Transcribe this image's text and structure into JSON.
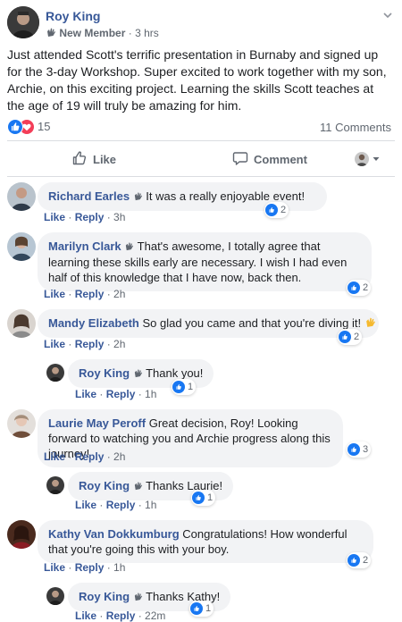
{
  "post": {
    "author": "Roy King",
    "badge": "New Member",
    "time": "3 hrs",
    "text": "Just attended Scott's terrific presentation in Burnaby and signed up for the 3-day Workshop. Super excited to work together with my son, Archie, on this exciting project. Learning the skills Scott teaches at the age of 19 will truly be amazing for him.",
    "reaction_count": "15",
    "comments_count": "11 Comments"
  },
  "actions": {
    "like": "Like",
    "comment": "Comment"
  },
  "comment_actions": {
    "like": "Like",
    "reply": "Reply"
  },
  "comments": [
    {
      "name": "Richard Earles",
      "text": "It was a really enjoyable event!",
      "time": "3h",
      "likes": "2"
    },
    {
      "name": "Marilyn Clark",
      "text": "That's awesome, I totally agree that learning these skills early are necessary. I wish I had even half of this knowledge that I have now, back then.",
      "time": "2h",
      "likes": "2"
    },
    {
      "name": "Mandy Elizabeth",
      "text": "So glad you came and that you're diving it!",
      "time": "2h",
      "likes": "2"
    },
    {
      "name": "Roy King",
      "text": "Thank you!",
      "time": "1h",
      "likes": "1"
    },
    {
      "name": "Laurie May Peroff",
      "text": "Great decision, Roy! Looking forward to watching you and Archie progress along this journey!",
      "time": "2h",
      "likes": "3"
    },
    {
      "name": "Roy King",
      "text": "Thanks Laurie!",
      "time": "1h",
      "likes": "1"
    },
    {
      "name": "Kathy Van Dokkumburg",
      "text": "Congratulations! How wonderful that you're going this with your boy.",
      "time": "1h",
      "likes": "2"
    },
    {
      "name": "Roy King",
      "text": "Thanks Kathy!",
      "time": "22m",
      "likes": "1"
    }
  ],
  "colors": {
    "link": "#385898",
    "like_blue": "#1877f2",
    "love_red": "#f33e58",
    "bubble": "#f2f3f5"
  }
}
